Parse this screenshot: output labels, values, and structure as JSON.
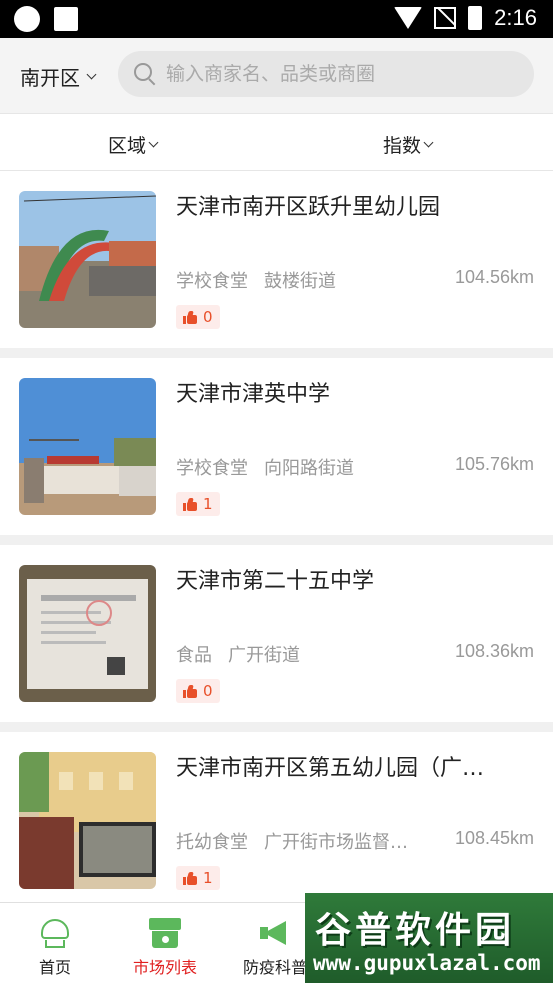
{
  "status_bar": {
    "time": "2:16"
  },
  "header": {
    "district": "南开区",
    "search_placeholder": "输入商家名、品类或商圈"
  },
  "filters": [
    {
      "label": "区域"
    },
    {
      "label": "指数"
    }
  ],
  "items": [
    {
      "title": "天津市南开区跃升里幼儿园",
      "category": "学校食堂",
      "street": "鼓楼街道",
      "distance": "104.56km",
      "likes": "0"
    },
    {
      "title": "天津市津英中学",
      "category": "学校食堂",
      "street": "向阳路街道",
      "distance": "105.76km",
      "likes": "1"
    },
    {
      "title": "天津市第二十五中学",
      "category": "食品",
      "street": "广开街道",
      "distance": "108.36km",
      "likes": "0"
    },
    {
      "title": "天津市南开区第五幼儿园（广…",
      "category": "托幼食堂",
      "street": "广开街市场监督…",
      "distance": "108.45km",
      "likes": "1"
    }
  ],
  "bottom_nav": [
    {
      "label": "首页",
      "icon": "chef-hat-icon"
    },
    {
      "label": "市场列表",
      "icon": "shop-icon",
      "active": true
    },
    {
      "label": "防疫科普",
      "icon": "megaphone-icon"
    }
  ],
  "watermark": {
    "text": "谷普软件园",
    "url": "www.gupuxlazal.com"
  },
  "colors": {
    "accent_green": "#5cb85c",
    "active_red": "#e02020",
    "like_orange": "#e8502a"
  }
}
